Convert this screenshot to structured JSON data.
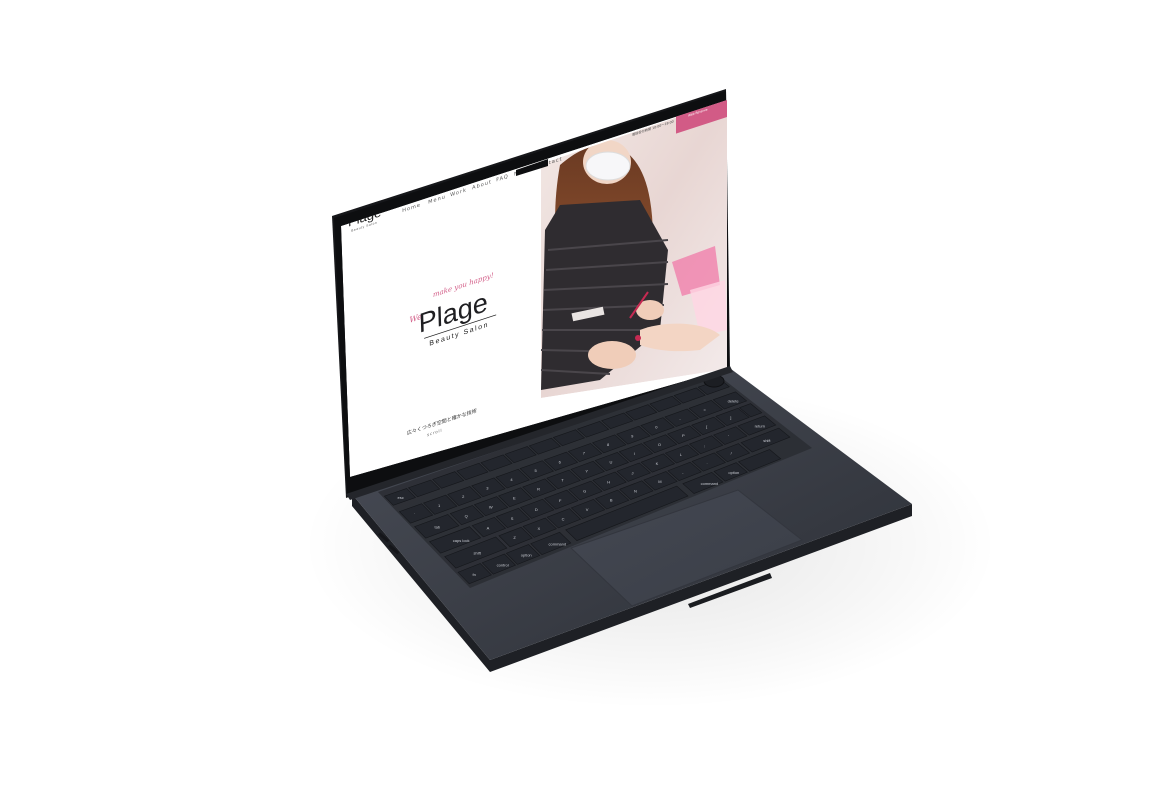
{
  "site": {
    "header_logo": "Plage",
    "header_logo_sub": "Beauty Salon",
    "nav": [
      "Home",
      "Menu",
      "Work",
      "About",
      "FAQ",
      "News",
      "Contact"
    ],
    "phone": "03-6808-7938",
    "phone_note": "電話受付時間 10:00～19:00",
    "reserve_button": "ご予約はこちら",
    "reserve_button_sub": "Web Reserve",
    "hero_script": "make you happy!",
    "hero_script_prefix": "We",
    "hero_logo": "Plage",
    "hero_sub": "Beauty Salon",
    "tagline": "広々くつろぎ空間と確かな技術",
    "tagline_sub": "scroll"
  },
  "keyboard": {
    "labels": {
      "esc": "esc",
      "tab": "tab",
      "caps": "caps lock",
      "shift": "shift",
      "fn": "fn",
      "control": "control",
      "option": "option",
      "command_l": "command",
      "command_r": "command",
      "option_r": "option",
      "return": "return",
      "delete": "delete",
      "rshift": "shift"
    },
    "row1": [
      "1",
      "2",
      "3",
      "4",
      "5",
      "6",
      "7",
      "8",
      "9",
      "0",
      "-",
      "="
    ],
    "row2": [
      "Q",
      "W",
      "E",
      "R",
      "T",
      "Y",
      "U",
      "I",
      "O",
      "P",
      "[",
      "]"
    ],
    "row3": [
      "A",
      "S",
      "D",
      "F",
      "G",
      "H",
      "J",
      "K",
      "L",
      ";",
      "'"
    ],
    "row4": [
      "Z",
      "X",
      "C",
      "V",
      "B",
      "N",
      "M",
      ",",
      ".",
      "/"
    ]
  },
  "colors": {
    "accent_pink": "#d25b86",
    "body_dark": "#3a3e47",
    "screen_bezel": "#111214"
  }
}
